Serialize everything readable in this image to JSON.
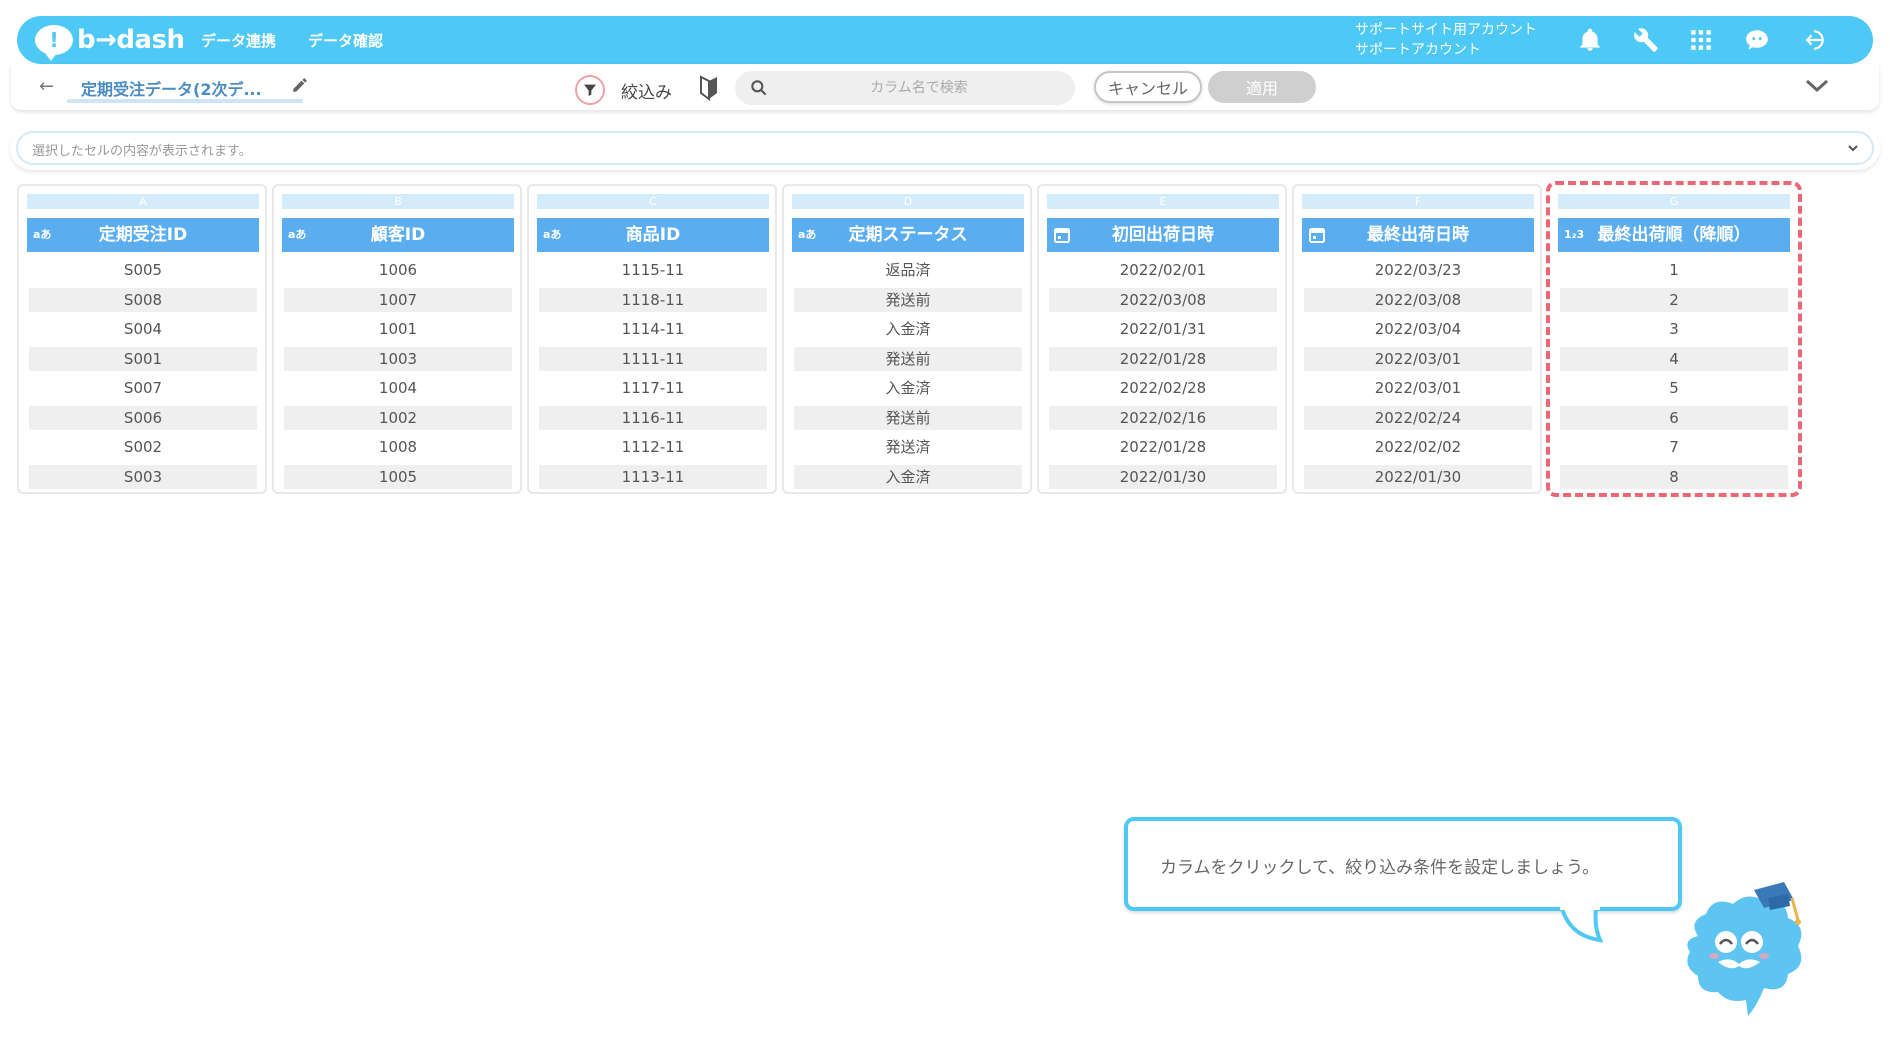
{
  "header": {
    "logo_text": "b→dash",
    "nav": [
      "データ連携",
      "データ確認"
    ],
    "account_line1": "サポートサイト用アカウント",
    "account_line2": "サポートアカウント"
  },
  "toolbar": {
    "title": "定期受注データ(2次デ...",
    "filter_label": "絞込み",
    "search_placeholder": "カラム名で検索",
    "cancel_label": "キャンセル",
    "apply_label": "適用"
  },
  "cellbar": {
    "placeholder": "選択したセルの内容が表示されます。"
  },
  "columns": [
    {
      "letter": "A",
      "type": "aあ",
      "name": "定期受注ID",
      "values": [
        "S005",
        "S008",
        "S004",
        "S001",
        "S007",
        "S006",
        "S002",
        "S003"
      ]
    },
    {
      "letter": "B",
      "type": "aあ",
      "name": "顧客ID",
      "values": [
        "1006",
        "1007",
        "1001",
        "1003",
        "1004",
        "1002",
        "1008",
        "1005"
      ]
    },
    {
      "letter": "C",
      "type": "aあ",
      "name": "商品ID",
      "values": [
        "1115-11",
        "1118-11",
        "1114-11",
        "1111-11",
        "1117-11",
        "1116-11",
        "1112-11",
        "1113-11"
      ]
    },
    {
      "letter": "D",
      "type": "aあ",
      "name": "定期ステータス",
      "values": [
        "返品済",
        "発送前",
        "入金済",
        "発送前",
        "入金済",
        "発送前",
        "発送済",
        "入金済"
      ]
    },
    {
      "letter": "E",
      "type": "calendar",
      "name": "初回出荷日時",
      "values": [
        "2022/02/01",
        "2022/03/08",
        "2022/01/31",
        "2022/01/28",
        "2022/02/28",
        "2022/02/16",
        "2022/01/28",
        "2022/01/30"
      ]
    },
    {
      "letter": "F",
      "type": "calendar",
      "name": "最終出荷日時",
      "values": [
        "2022/03/23",
        "2022/03/08",
        "2022/03/04",
        "2022/03/01",
        "2022/03/01",
        "2022/02/24",
        "2022/02/02",
        "2022/01/30"
      ]
    },
    {
      "letter": "G",
      "type": "1₂3",
      "name": "最終出荷順（降順）",
      "values": [
        "1",
        "2",
        "3",
        "4",
        "5",
        "6",
        "7",
        "8"
      ]
    }
  ],
  "tooltip": {
    "text": "カラムをクリックして、絞り込み条件を設定しましょう。"
  },
  "colors": {
    "brand": "#4ec8f4",
    "column_header": "#5aaef0",
    "highlight": "#ec6675"
  }
}
